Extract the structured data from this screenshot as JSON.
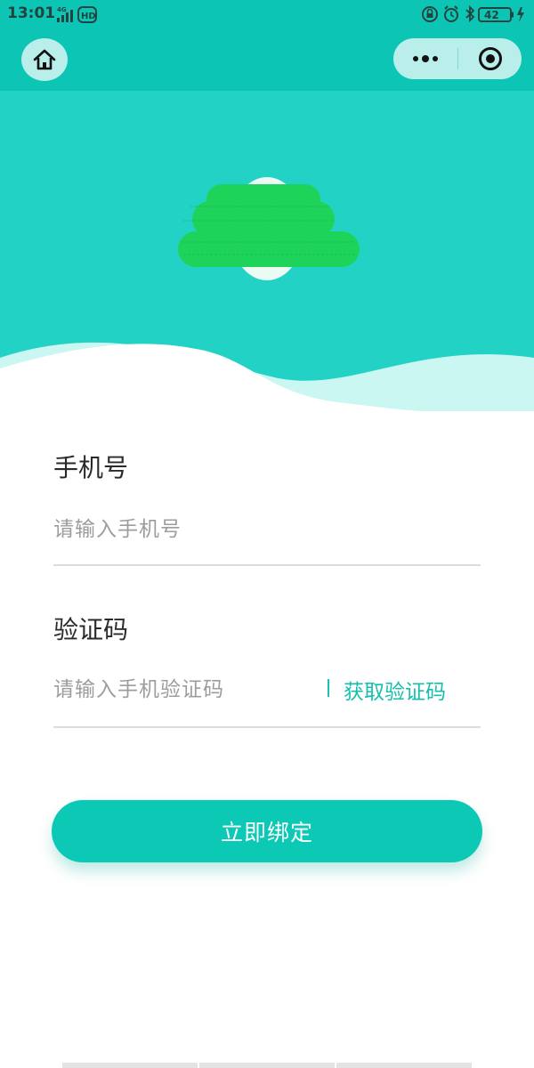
{
  "status_bar": {
    "time": "13:01",
    "network": "4G",
    "hd": "HD",
    "battery": "42"
  },
  "form": {
    "phone_label": "手机号",
    "phone_placeholder": "请输入手机号",
    "code_label": "验证码",
    "code_placeholder": "请输入手机验证码",
    "get_code_label": "获取验证码"
  },
  "actions": {
    "bind_label": "立即绑定"
  },
  "colors": {
    "brand": "#0cc5b4",
    "hero": "#22d3c5",
    "wave_light": "#cbf7f3",
    "button": "#0cc9b5"
  },
  "icons": {
    "home": "home-icon",
    "more": "more-dots-icon",
    "close": "close-target-icon",
    "logo": "cloud-logo"
  }
}
